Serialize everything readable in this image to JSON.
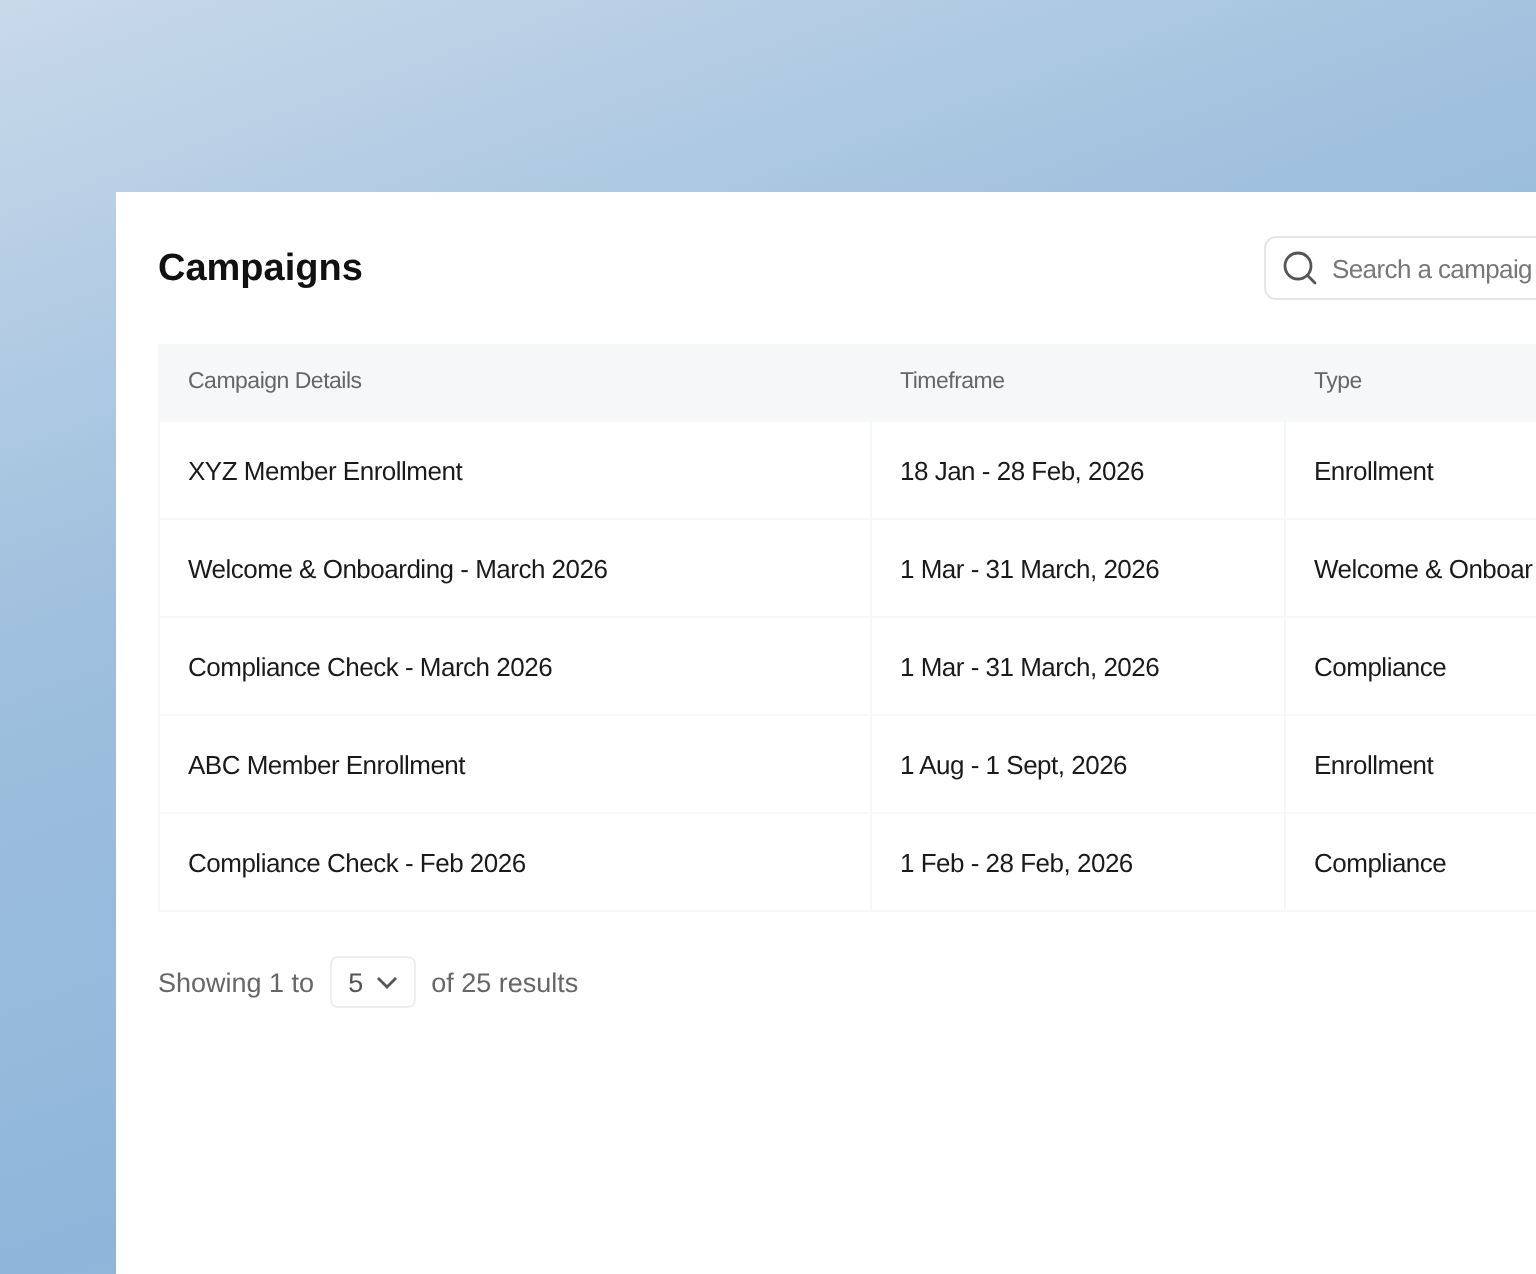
{
  "title": "Campaigns",
  "search": {
    "placeholder": "Search a campaig"
  },
  "table": {
    "columns": [
      "Campaign Details",
      "Timeframe",
      "Type"
    ],
    "rows": [
      [
        "XYZ Member Enrollment",
        "18 Jan - 28 Feb, 2026",
        "Enrollment"
      ],
      [
        "Welcome & Onboarding - March 2026",
        "1 Mar -  31 March, 2026",
        "Welcome & Onboar"
      ],
      [
        "Compliance Check - March 2026",
        "1 Mar -  31 March, 2026",
        "Compliance"
      ],
      [
        "ABC Member Enrollment",
        "1 Aug - 1 Sept, 2026",
        "Enrollment"
      ],
      [
        "Compliance Check - Feb 2026",
        "1 Feb -  28 Feb, 2026",
        "Compliance"
      ]
    ]
  },
  "pagination": {
    "prefix": "Showing 1 to",
    "page_size": "5",
    "suffix": "of 25 results"
  }
}
